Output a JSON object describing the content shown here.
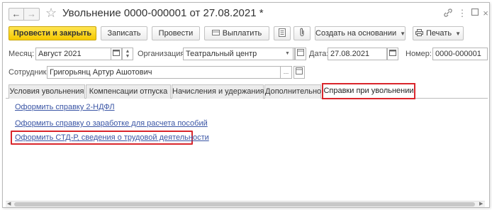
{
  "window": {
    "title": "Увольнение 0000-000001 от 27.08.2021 *"
  },
  "toolbar": {
    "post_close": "Провести и закрыть",
    "save": "Записать",
    "post": "Провести",
    "pay": "Выплатить",
    "create_based": "Создать на основании",
    "print": "Печать"
  },
  "form": {
    "month_label": "Месяц:",
    "month_value": "Август 2021",
    "org_label": "Организация:",
    "org_value": "Театральный центр",
    "date_label": "Дата:",
    "date_value": "27.08.2021",
    "number_label": "Номер:",
    "number_value": "0000-000001",
    "employee_label": "Сотрудник:",
    "employee_value": "Григорьянц Артур Ашотович"
  },
  "tabs": [
    {
      "label": "Условия увольнения"
    },
    {
      "label": "Компенсации отпуска"
    },
    {
      "label": "Начисления и удержания"
    },
    {
      "label": "Дополнительно"
    },
    {
      "label": "Справки при увольнении"
    }
  ],
  "links": [
    {
      "text": "Оформить справку 2-НДФЛ"
    },
    {
      "text": "Оформить справку о заработке для расчета пособий"
    },
    {
      "text": "Оформить СТД-Р, сведения о трудовой деятельности"
    }
  ],
  "colors": {
    "primary_button": "#f5c900",
    "highlight": "#d9262c",
    "link": "#3a55a5"
  }
}
